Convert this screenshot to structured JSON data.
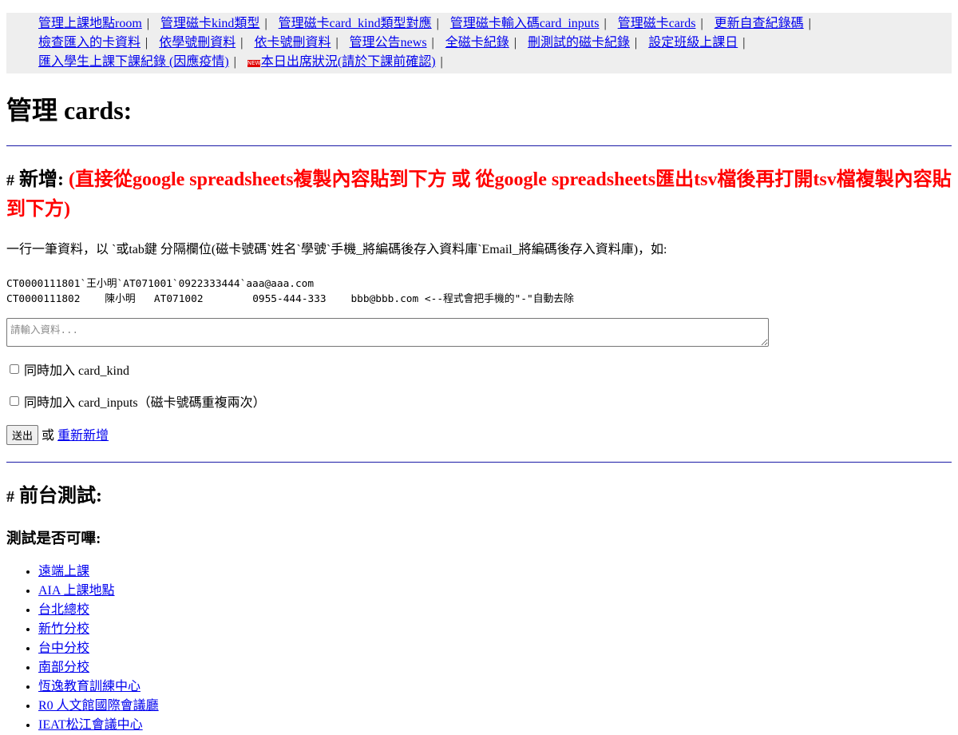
{
  "nav": {
    "items": [
      {
        "label": "管理上課地點room"
      },
      {
        "label": "管理磁卡kind類型"
      },
      {
        "label": "管理磁卡card_kind類型對應"
      },
      {
        "label": "管理磁卡輸入碼card_inputs"
      },
      {
        "label": "管理磁卡cards"
      },
      {
        "label": "更新自查紀錄碼"
      },
      {
        "label": "檢查匯入的卡資料"
      },
      {
        "label": "依學號刪資料"
      },
      {
        "label": "依卡號刪資料"
      },
      {
        "label": "管理公告news"
      },
      {
        "label": "全磁卡紀錄"
      },
      {
        "label": "刪測試的磁卡紀錄"
      },
      {
        "label": "設定班級上課日"
      },
      {
        "label": "匯入學生上課下課紀錄 (因應疫情)"
      },
      {
        "label": "本日出席狀況(請於下課前確認)",
        "hot_icon": "hot-new-icon"
      }
    ],
    "separator": "|"
  },
  "page_title": "管理 cards:",
  "add_section": {
    "hash": "#",
    "heading": "新增:",
    "heading_note": "(直接從google spreadsheets複製內容貼到下方 或 從google spreadsheets匯出tsv檔後再打開tsv檔複製內容貼到下方)",
    "description": "一行一筆資料，以 `或tab鍵 分隔欄位(磁卡號碼`姓名`學號`手機_將編碼後存入資料庫`Email_將編碼後存入資料庫)，如:",
    "example": "CT0000111801`王小明`AT071001`0922333444`aaa@aaa.com\nCT0000111802\t陳小明\tAT071002\t0955-444-333\tbbb@bbb.com <--程式會把手機的\"-\"自動去除",
    "textarea_placeholder": "請輸入資料...",
    "textarea_value": "",
    "checkbox_card_kind_label": "同時加入 card_kind",
    "checkbox_card_kind_checked": false,
    "checkbox_card_inputs_label": "同時加入 card_inputs（磁卡號碼重複兩次）",
    "checkbox_card_inputs_checked": false,
    "submit_label": "送出",
    "or_text": "或",
    "reset_link_label": "重新新增"
  },
  "test_section": {
    "hash": "#",
    "heading": "前台測試:",
    "subheading": "測試是否可嗶:",
    "links": [
      {
        "label": "遠端上課"
      },
      {
        "label": "AIA 上課地點"
      },
      {
        "label": "台北總校"
      },
      {
        "label": "新竹分校"
      },
      {
        "label": "台中分校"
      },
      {
        "label": "南部分校"
      },
      {
        "label": "恆逸教育訓練中心"
      },
      {
        "label": "R0 人文館國際會議廳"
      },
      {
        "label": "IEAT松江會議中心"
      }
    ]
  },
  "colors": {
    "link": "#0000ee",
    "heading_note": "#ff0000",
    "nav_background": "#eeeeee",
    "rule": "#1a1aa6"
  }
}
